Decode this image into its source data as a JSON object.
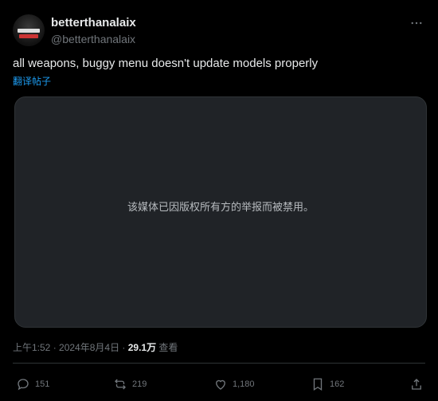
{
  "post": {
    "author": {
      "display_name": "betterthanalaix",
      "handle": "@betterthanalaix"
    },
    "more_icon": "more-horizontal-icon",
    "text": "all weapons, buggy menu doesn't update models properly",
    "translate_label": "翻译帖子",
    "media": {
      "message": "该媒体已因版权所有方的举报而被禁用。"
    },
    "meta": {
      "time": "上午1:52 · 2024年8月4日 · ",
      "views_count": "29.1万",
      "views_label": " 查看"
    },
    "actions": {
      "replies": "151",
      "reposts": "219",
      "likes": "1,180",
      "bookmarks": "162"
    }
  },
  "colors": {
    "background": "#000000",
    "text": "#e7e9ea",
    "muted": "#71767b",
    "accent": "#1d9bf0",
    "media_bg": "#202327"
  }
}
